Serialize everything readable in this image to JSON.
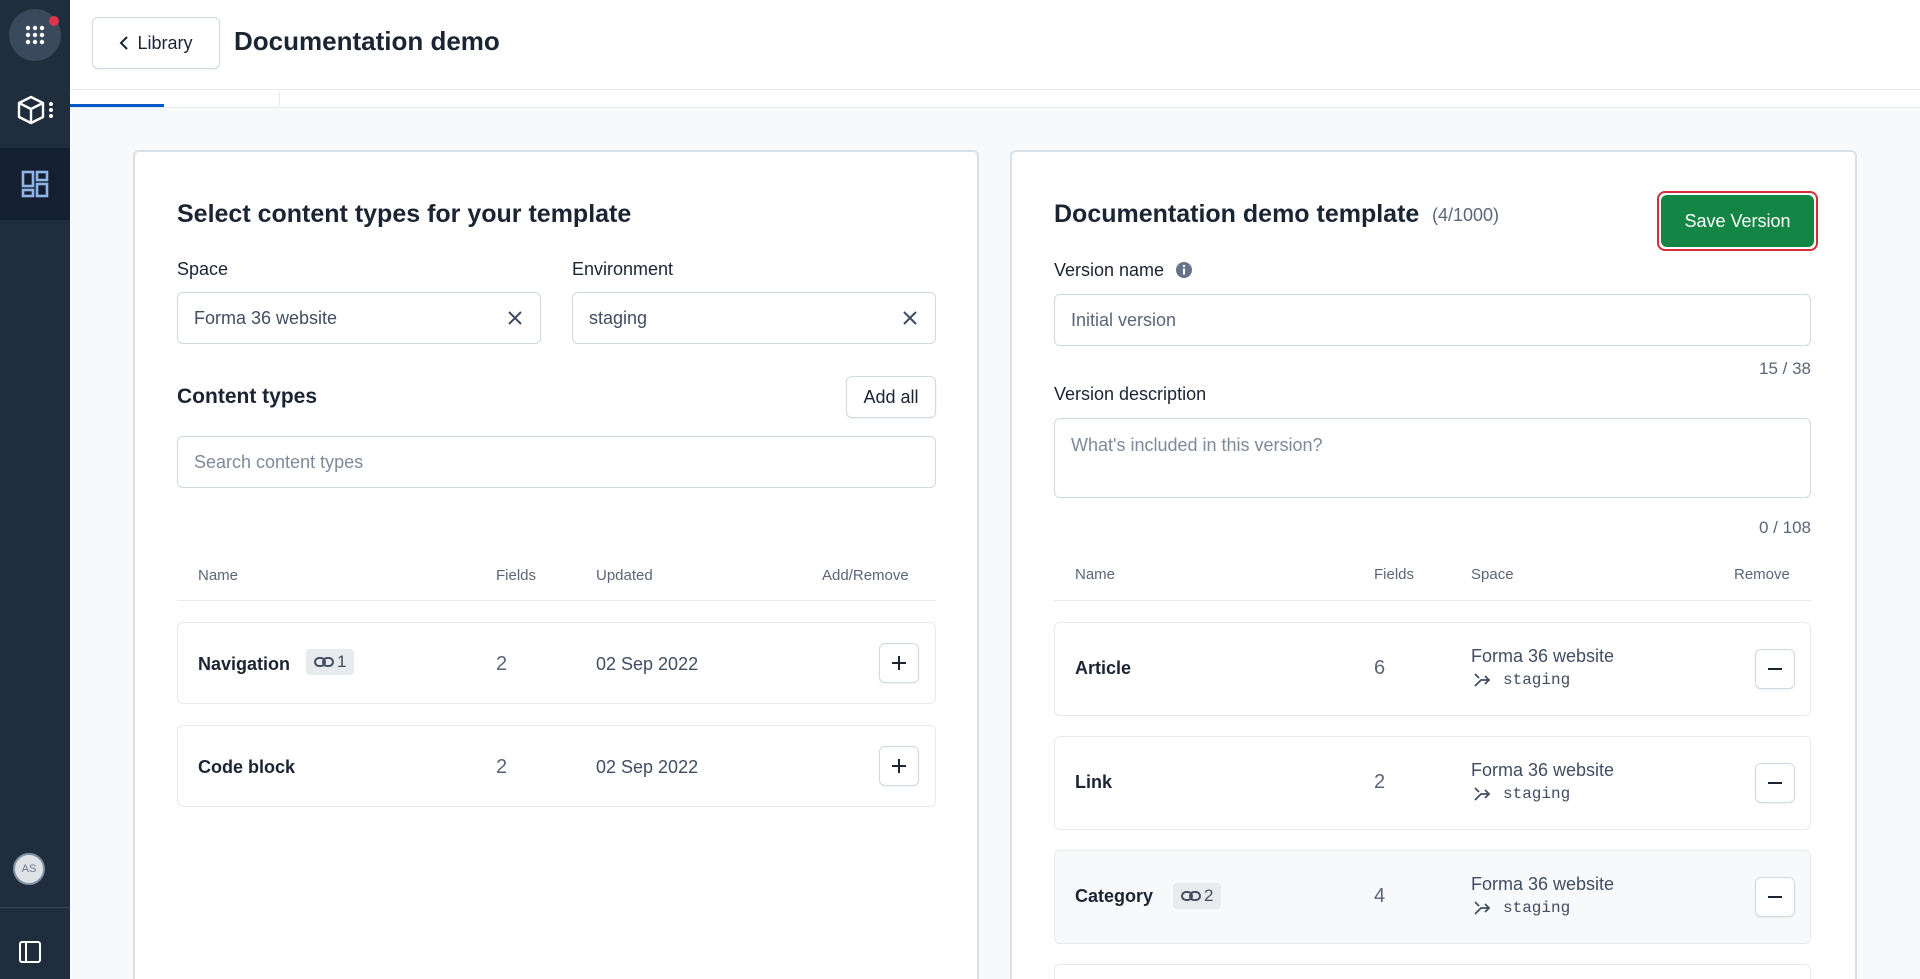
{
  "sidebar": {
    "avatar_initials": "AS"
  },
  "header": {
    "back_label": "Library",
    "title": "Documentation demo"
  },
  "left": {
    "heading": "Select content types for your template",
    "space_label": "Space",
    "space_value": "Forma 36 website",
    "env_label": "Environment",
    "env_value": "staging",
    "content_types_label": "Content types",
    "add_all_label": "Add all",
    "search_placeholder": "Search content types",
    "columns": {
      "name": "Name",
      "fields": "Fields",
      "updated": "Updated",
      "action": "Add/Remove"
    },
    "rows": [
      {
        "name": "Navigation",
        "badge": "1",
        "fields": "2",
        "updated": "02 Sep 2022"
      },
      {
        "name": "Code block",
        "fields": "2",
        "updated": "02 Sep 2022"
      }
    ]
  },
  "right": {
    "heading": "Documentation demo template",
    "count": "(4/1000)",
    "save_label": "Save Version",
    "version_name_label": "Version name",
    "version_name_placeholder": "Initial version",
    "version_name_counter": "15 / 38",
    "version_desc_label": "Version description",
    "version_desc_placeholder": "What's included in this version?",
    "version_desc_counter": "0 / 108",
    "columns": {
      "name": "Name",
      "fields": "Fields",
      "space": "Space",
      "remove": "Remove"
    },
    "rows": [
      {
        "name": "Article",
        "fields": "6",
        "space": "Forma 36 website",
        "env": "staging"
      },
      {
        "name": "Link",
        "fields": "2",
        "space": "Forma 36 website",
        "env": "staging"
      },
      {
        "name": "Category",
        "badge": "2",
        "fields": "4",
        "space": "Forma 36 website",
        "env": "staging"
      }
    ]
  },
  "colors": {
    "accent": "#0059c8",
    "save": "#138544",
    "sidebar": "#1f2d3d"
  }
}
